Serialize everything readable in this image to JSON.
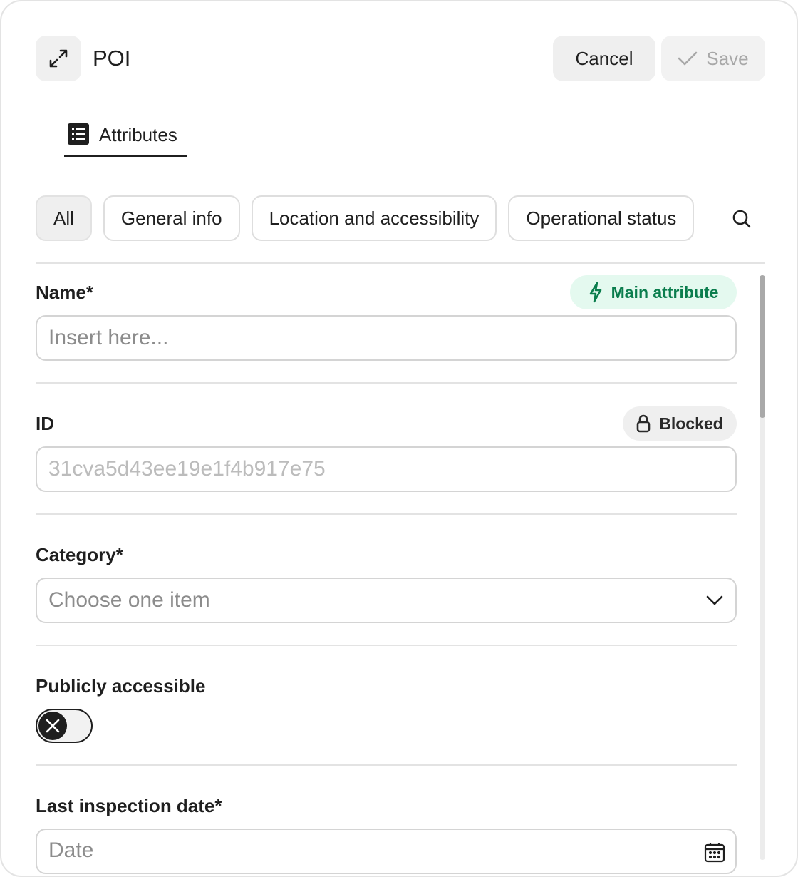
{
  "header": {
    "title": "POI",
    "cancel_label": "Cancel",
    "save_label": "Save"
  },
  "tabs": [
    {
      "label": "Attributes",
      "active": true
    }
  ],
  "filters": {
    "chips": [
      "All",
      "General info",
      "Location and accessibility",
      "Operational status"
    ],
    "active": "All"
  },
  "fields": {
    "name": {
      "label": "Name*",
      "placeholder": "Insert here...",
      "badge": "Main attribute"
    },
    "id": {
      "label": "ID",
      "value": "31cva5d43ee19e1f4b917e75",
      "badge": "Blocked"
    },
    "category": {
      "label": "Category*",
      "placeholder": "Choose one item"
    },
    "publicly_accessible": {
      "label": "Publicly accessible",
      "enabled": false
    },
    "last_inspection_date": {
      "label": "Last inspection date*",
      "placeholder": "Date"
    }
  },
  "colors": {
    "accent_green": "#0a7d4d",
    "badge_green_bg": "#e4f9ef",
    "text": "#1f1f1f",
    "border": "#d4d4d4"
  },
  "icons": {
    "expand": "expand-arrows-icon",
    "save": "check-icon",
    "tab": "list-icon",
    "search": "search-icon",
    "main_attribute": "lightning-icon",
    "blocked": "lock-icon",
    "category": "chevron-down-icon",
    "toggle": "x-icon",
    "date": "calendar-icon"
  }
}
